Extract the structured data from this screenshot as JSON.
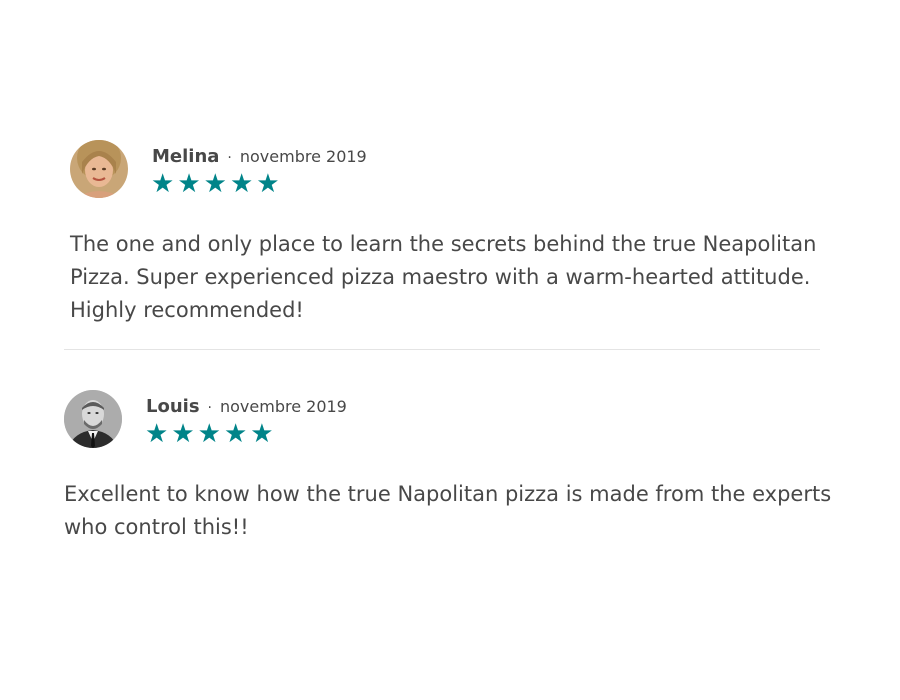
{
  "reviews": [
    {
      "name": "Melina",
      "separator": "·",
      "date": "novembre 2019",
      "rating": 5,
      "avatar_icon": "user-photo-melina",
      "comment": "The one and only place to learn the secrets behind the true Neapolitan Pizza. Super experienced pizza maestro with a warm-hearted attitude. Highly recommended!"
    },
    {
      "name": "Louis",
      "separator": "·",
      "date": "novembre 2019",
      "rating": 5,
      "avatar_icon": "user-photo-louis",
      "comment": "Excellent to know how the true Napolitan pizza is made from the experts who control this!!"
    }
  ],
  "colors": {
    "star": "#008489",
    "text": "#484848",
    "divider": "#e4e4e4"
  }
}
